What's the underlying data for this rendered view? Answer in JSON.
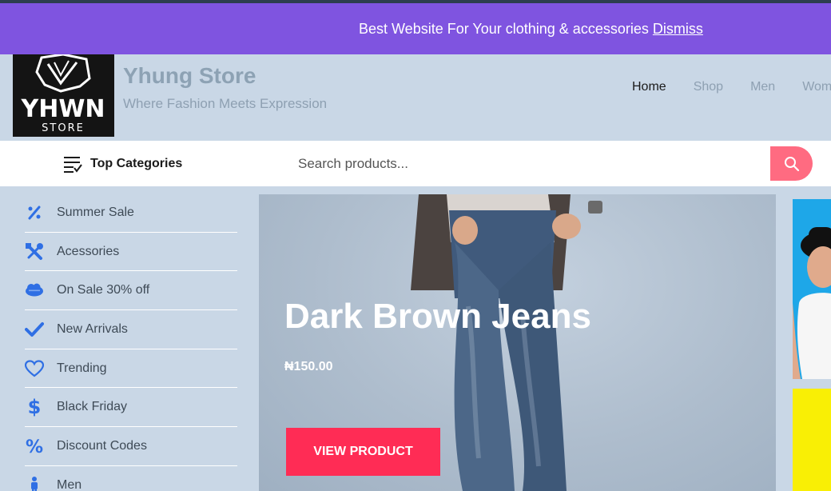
{
  "notice": {
    "text": "Best Website For Your clothing & accessories",
    "dismiss": "Dismiss"
  },
  "header": {
    "logo_text": "YHWN",
    "logo_sub": "STORE",
    "title": "Yhung Store",
    "tagline": "Where Fashion Meets Expression",
    "nav": [
      {
        "label": "Home",
        "active": true
      },
      {
        "label": "Shop"
      },
      {
        "label": "Men"
      },
      {
        "label": "Women"
      }
    ]
  },
  "catbar": {
    "top_categories": "Top Categories",
    "search_placeholder": "Search products...",
    "accent": "#ff6b81"
  },
  "sidebar": {
    "icon_color": "#2f6fe4",
    "items": [
      {
        "label": "Summer Sale",
        "icon": "percent-icon"
      },
      {
        "label": "Acessories",
        "icon": "tools-icon"
      },
      {
        "label": "On Sale 30% off",
        "icon": "salesforce-cloud-icon"
      },
      {
        "label": "New Arrivals",
        "icon": "check-icon"
      },
      {
        "label": "Trending",
        "icon": "heart-icon"
      },
      {
        "label": "Black Friday",
        "icon": "dollar-icon"
      },
      {
        "label": "Discount Codes",
        "icon": "percent-icon"
      },
      {
        "label": "Men",
        "icon": "male-icon"
      }
    ]
  },
  "hero": {
    "title": "Dark Brown Jeans",
    "price": "₦150.00",
    "button": "VIEW PRODUCT",
    "button_color": "#ff2c55"
  },
  "colors": {
    "notice_bg": "#7f54e0",
    "page_bg": "#c9d7e6"
  }
}
